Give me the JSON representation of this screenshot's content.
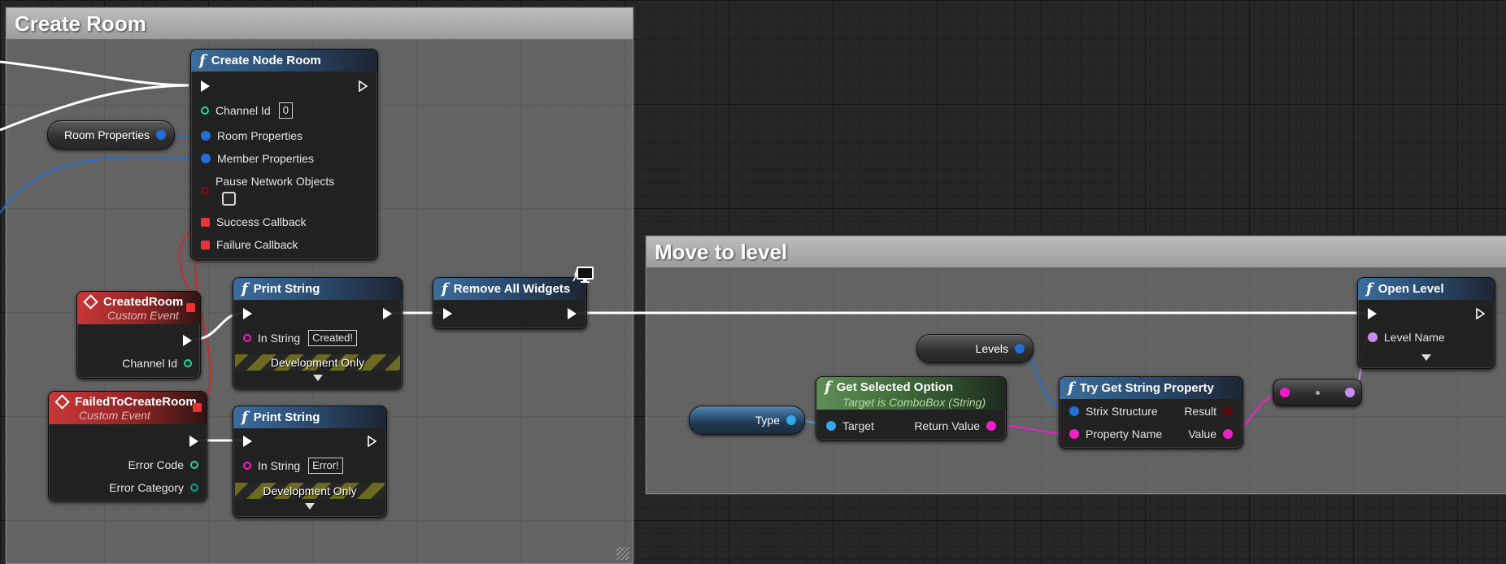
{
  "comments": {
    "create_room": "Create Room",
    "move_to_level": "Move to level"
  },
  "create_node_room": {
    "title": "Create Node Room",
    "channel_id_label": "Channel Id",
    "channel_id_value": "0",
    "room_properties": "Room Properties",
    "member_properties": "Member Properties",
    "pause_network_objects": "Pause Network Objects",
    "success_callback": "Success Callback",
    "failure_callback": "Failure Callback"
  },
  "room_properties_var": {
    "label": "Room Properties"
  },
  "created_room_event": {
    "title": "CreatedRoom",
    "subtitle": "Custom Event",
    "channel_id": "Channel Id"
  },
  "failed_event": {
    "title": "FailedToCreateRoom",
    "subtitle": "Custom Event",
    "error_code": "Error Code",
    "error_category": "Error Category"
  },
  "print_string_1": {
    "title": "Print String",
    "in_string_label": "In String",
    "in_string_value": "Created!",
    "dev_only": "Development Only"
  },
  "print_string_2": {
    "title": "Print String",
    "in_string_label": "In String",
    "in_string_value": "Error!",
    "dev_only": "Development Only"
  },
  "remove_all_widgets": {
    "title": "Remove All Widgets"
  },
  "open_level": {
    "title": "Open Level",
    "level_name": "Level Name"
  },
  "levels_var": {
    "label": "Levels"
  },
  "type_var": {
    "label": "Type"
  },
  "get_selected_option": {
    "title": "Get Selected Option",
    "subtitle": "Target is ComboBox (String)",
    "target": "Target",
    "return_value": "Return Value"
  },
  "try_get_string_property": {
    "title": "Try Get String Property",
    "strix_structure": "Strix Structure",
    "result": "Result",
    "property_name": "Property Name",
    "value": "Value"
  },
  "colors": {
    "exec": "#ffffff",
    "struct": "#1f6fd6",
    "string": "#f01fc8",
    "name": "#c88cf0",
    "integer": "#1fd6a0",
    "boolean": "#8c0a0a",
    "delegate": "#e83434",
    "object": "#34a8e8"
  }
}
